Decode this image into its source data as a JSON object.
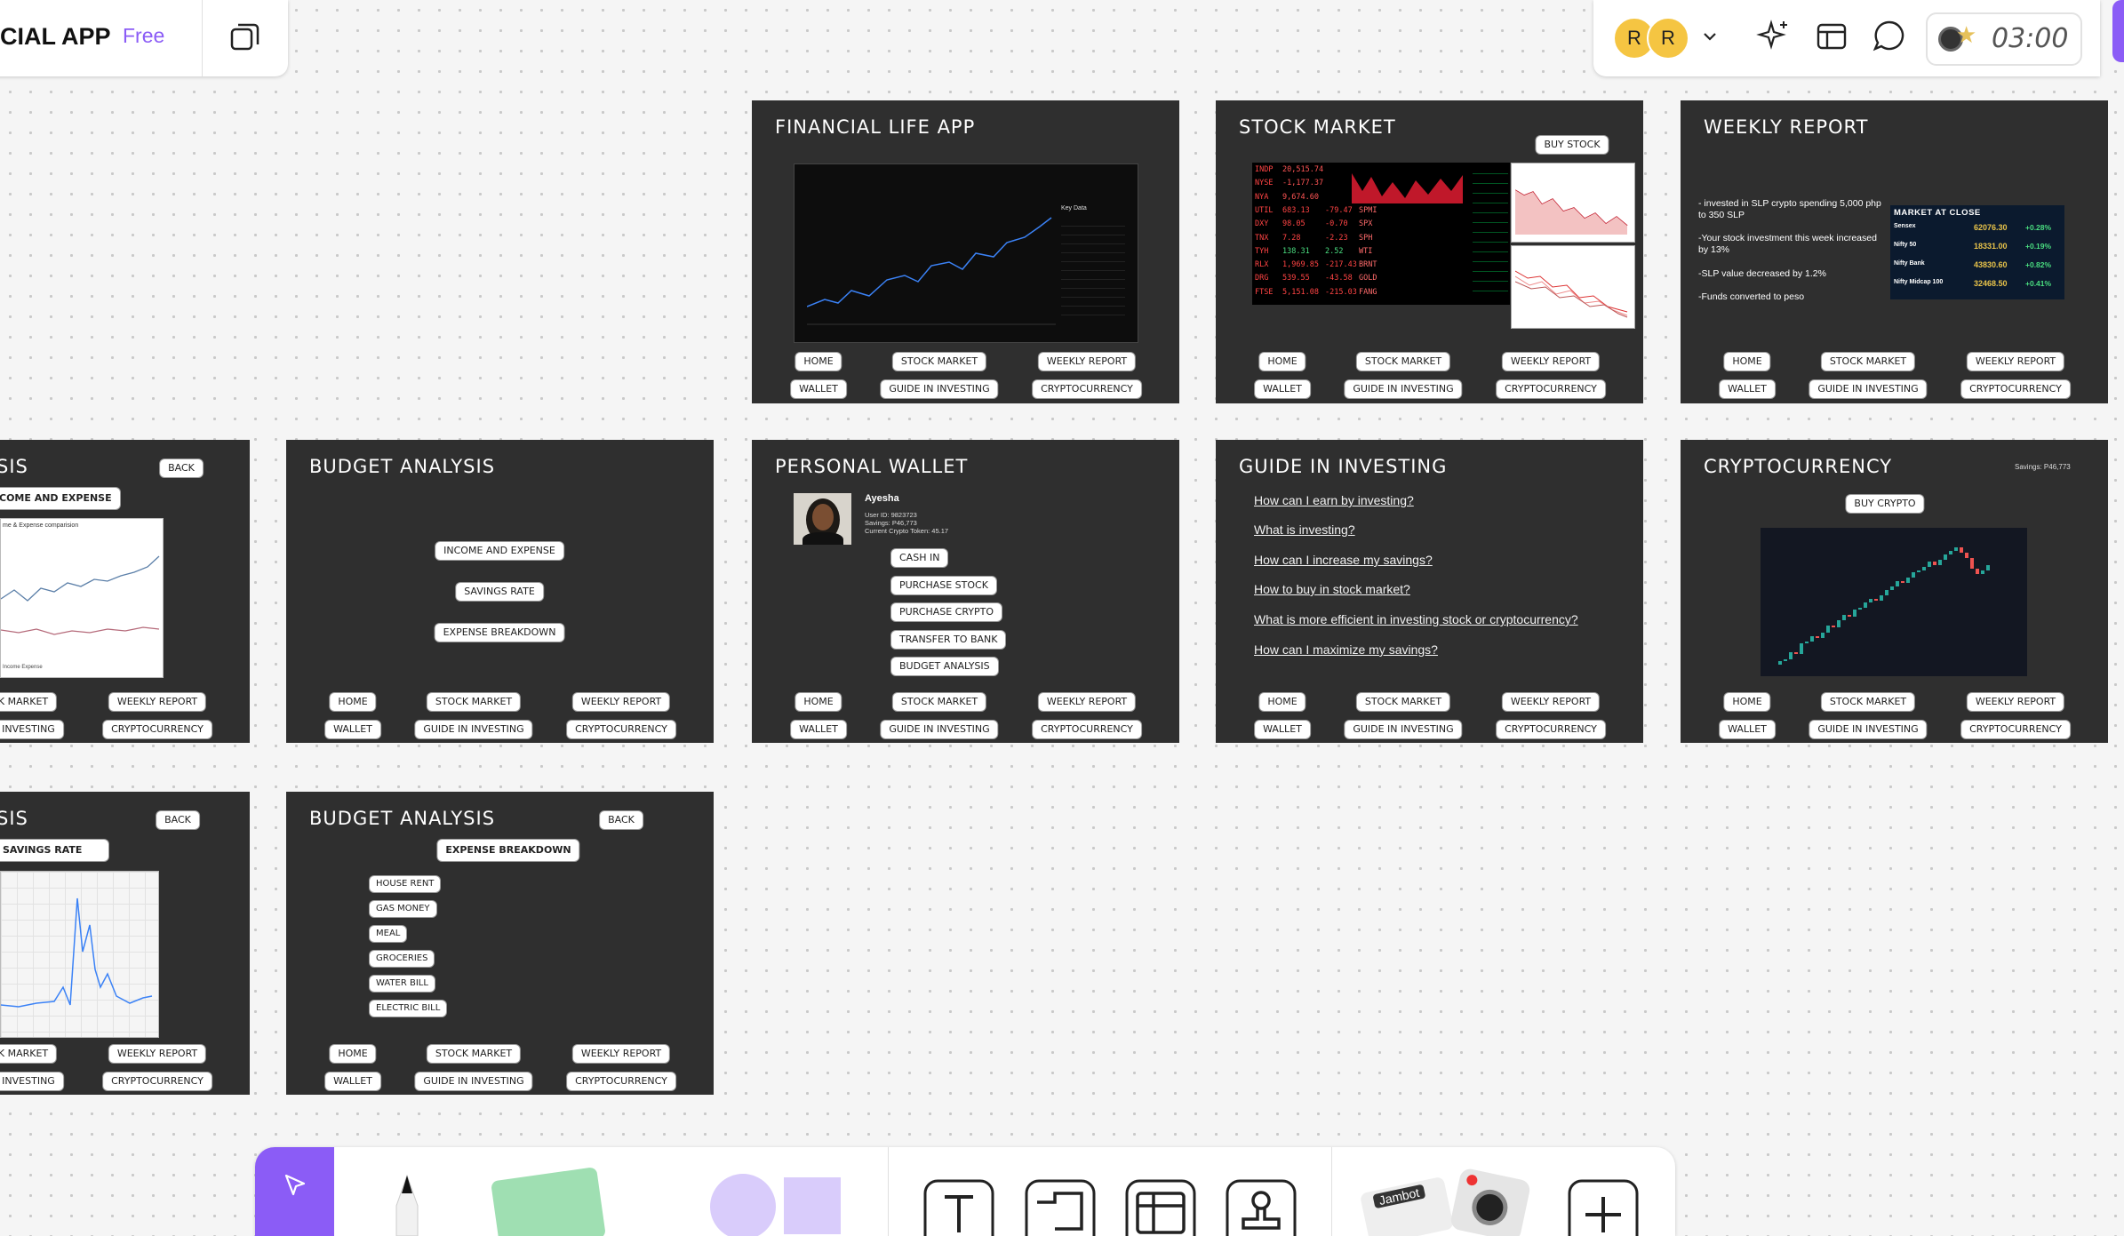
{
  "app": {
    "title": "CIAL APP",
    "plan": "Free"
  },
  "topbar": {
    "avatar1": "R",
    "avatar2": "R",
    "timer": "03:00"
  },
  "nav": {
    "home": "HOME",
    "stock_market": "STOCK MARKET",
    "weekly_report": "WEEKLY REPORT",
    "wallet": "WALLET",
    "guide": "GUIDE IN INVESTING",
    "crypto": "CRYPTOCURRENCY",
    "stock_market_cut": "K MARKET",
    "guide_cut": "INVESTING"
  },
  "back_label": "BACK",
  "frames": {
    "financial": {
      "title": "FINANCIAL LIFE APP",
      "chart_label": "Key Data"
    },
    "stock": {
      "title": "STOCK MARKET",
      "buy": "BUY STOCK"
    },
    "weekly": {
      "title": "WEEKLY REPORT",
      "bullets": [
        "- invested in SLP crypto spending 5,000 php to 350 SLP",
        "-Your stock investment this week increased by 13%",
        "-SLP value decreased by 1.2%",
        "-Funds converted to peso"
      ],
      "market_title": "MARKET AT CLOSE",
      "market_rows": [
        [
          "Sensex",
          "62076.30",
          "+0.28%"
        ],
        [
          "Nifty 50",
          "18331.00",
          "+0.19%"
        ],
        [
          "Nifty Bank",
          "43830.60",
          "+0.82%"
        ],
        [
          "Nifty Midcap 100",
          "32468.50",
          "+0.41%"
        ]
      ]
    },
    "budget_left_top": {
      "title": "SIS",
      "chip": "COME AND EXPENSE",
      "chart_title": "me & Expense comparision",
      "legend": "Income   Expense"
    },
    "budget": {
      "title": "BUDGET ANALYSIS",
      "options": [
        "INCOME AND EXPENSE",
        "SAVINGS RATE",
        "EXPENSE BREAKDOWN"
      ]
    },
    "wallet": {
      "title": "PERSONAL WALLET",
      "name": "Ayesha",
      "user_id": "User ID: 9823723",
      "savings": "Savings: P46,773",
      "token": "Current Crypto Token: 45.17",
      "actions": [
        "CASH IN",
        "PURCHASE STOCK",
        "PURCHASE CRYPTO",
        "TRANSFER TO BANK",
        "BUDGET ANALYSIS"
      ]
    },
    "guide": {
      "title": "GUIDE IN INVESTING",
      "links": [
        "How can I earn by investing?",
        "What is investing?",
        "How can I increase my savings?",
        "How to buy in stock market?",
        "What is more efficient in investing stock or cryptocurrency?",
        "How can I maximize my savings?"
      ]
    },
    "crypto": {
      "title": "CRYPTOCURRENCY",
      "savings": "Savings: P46,773",
      "buy": "BUY CRYPTO"
    },
    "budget_left_bottom": {
      "title": "SIS",
      "chip": "SAVINGS RATE"
    },
    "expense": {
      "title": "BUDGET ANALYSIS",
      "chip": "EXPENSE BREAKDOWN",
      "items": [
        "HOUSE RENT",
        "GAS MONEY",
        "MEAL",
        "GROCERIES",
        "WATER BILL",
        "ELECTRIC BILL"
      ]
    }
  },
  "tickers": [
    [
      "INDP",
      "20,515.74",
      "",
      ""
    ],
    [
      "NYSE",
      "-1,177.37",
      "",
      ""
    ],
    [
      "NYA",
      "9,674.60",
      "",
      ""
    ],
    [
      "UTIL",
      "683.13",
      "-79.47",
      "SPMI"
    ],
    [
      "DXY",
      "98.05",
      "-0.70",
      "SPX"
    ],
    [
      "TNX",
      "7.28",
      "-2.23",
      "SPH"
    ],
    [
      "TYH",
      "138.31",
      "2.52",
      "WTI"
    ],
    [
      "RLX",
      "1,969.85",
      "-217.43",
      "BRNT"
    ],
    [
      "DRG",
      "539.55",
      "-43.58",
      "GOLD"
    ],
    [
      "FTSE",
      "5,151.08",
      "-215.03",
      "FANG"
    ]
  ],
  "bottom_toolbar": {
    "sticker": "Jambot"
  },
  "colors": {
    "frame": "#2f2f2f",
    "accent": "#8b5cf6",
    "avatar": "#f5c542"
  }
}
